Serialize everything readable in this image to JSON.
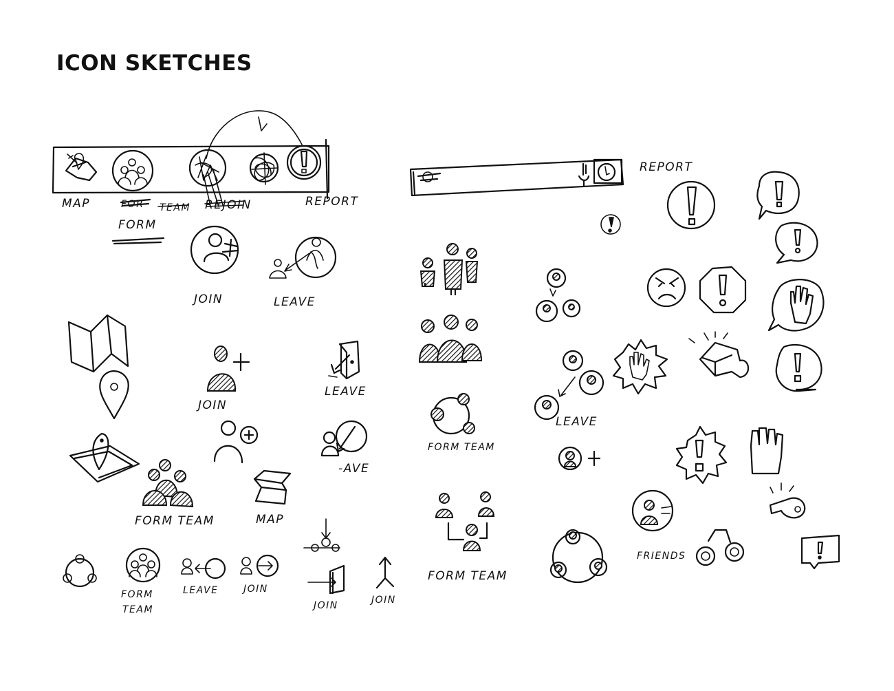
{
  "title": "ICON SKETCHES",
  "toolbar_labels": {
    "map": "MAP",
    "form": "FORM",
    "rejoin": "REJOIN",
    "report": "REPORT"
  },
  "report_label": "REPORT",
  "labels": {
    "join_top": "JOIN",
    "leave_top": "LEAVE",
    "join_mid": "JOIN",
    "leave_mid": "LEAVE",
    "leave_partial": "-AVE",
    "form_team_left": "FORM TEAM",
    "map_bottom": "MAP",
    "form_team_circle": "FORM TEAM",
    "form_team_bottom": "FORM TEAM",
    "leave_group": "LEAVE",
    "friends": "FRIENDS",
    "form_small": "FORM",
    "team_small": "TEAM",
    "leave_small": "LEAVE",
    "join_small": "JOIN",
    "join_door": "JOIN",
    "join_arrow": "JOIN"
  }
}
